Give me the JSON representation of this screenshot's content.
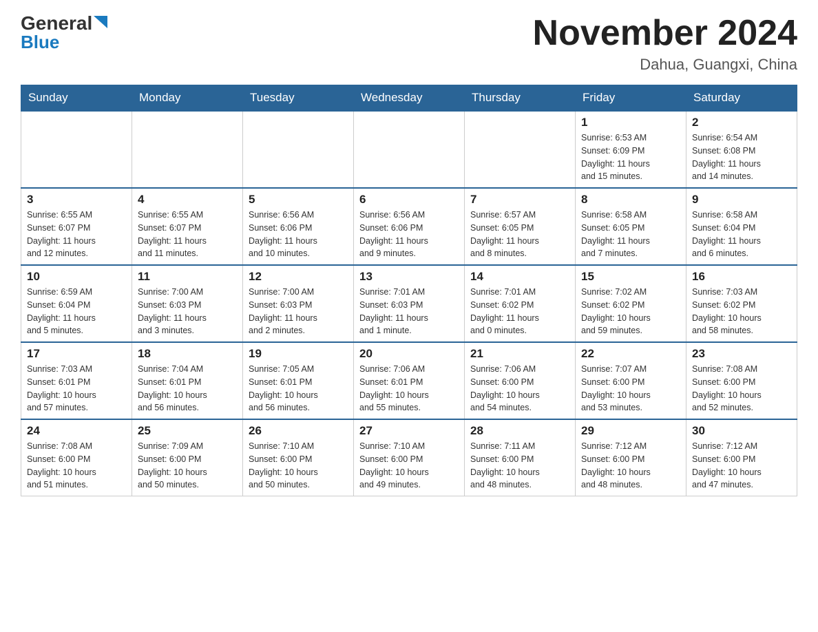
{
  "header": {
    "logo_general": "General",
    "logo_blue": "Blue",
    "month_title": "November 2024",
    "subtitle": "Dahua, Guangxi, China"
  },
  "weekdays": [
    "Sunday",
    "Monday",
    "Tuesday",
    "Wednesday",
    "Thursday",
    "Friday",
    "Saturday"
  ],
  "weeks": [
    [
      {
        "day": "",
        "info": ""
      },
      {
        "day": "",
        "info": ""
      },
      {
        "day": "",
        "info": ""
      },
      {
        "day": "",
        "info": ""
      },
      {
        "day": "",
        "info": ""
      },
      {
        "day": "1",
        "info": "Sunrise: 6:53 AM\nSunset: 6:09 PM\nDaylight: 11 hours\nand 15 minutes."
      },
      {
        "day": "2",
        "info": "Sunrise: 6:54 AM\nSunset: 6:08 PM\nDaylight: 11 hours\nand 14 minutes."
      }
    ],
    [
      {
        "day": "3",
        "info": "Sunrise: 6:55 AM\nSunset: 6:07 PM\nDaylight: 11 hours\nand 12 minutes."
      },
      {
        "day": "4",
        "info": "Sunrise: 6:55 AM\nSunset: 6:07 PM\nDaylight: 11 hours\nand 11 minutes."
      },
      {
        "day": "5",
        "info": "Sunrise: 6:56 AM\nSunset: 6:06 PM\nDaylight: 11 hours\nand 10 minutes."
      },
      {
        "day": "6",
        "info": "Sunrise: 6:56 AM\nSunset: 6:06 PM\nDaylight: 11 hours\nand 9 minutes."
      },
      {
        "day": "7",
        "info": "Sunrise: 6:57 AM\nSunset: 6:05 PM\nDaylight: 11 hours\nand 8 minutes."
      },
      {
        "day": "8",
        "info": "Sunrise: 6:58 AM\nSunset: 6:05 PM\nDaylight: 11 hours\nand 7 minutes."
      },
      {
        "day": "9",
        "info": "Sunrise: 6:58 AM\nSunset: 6:04 PM\nDaylight: 11 hours\nand 6 minutes."
      }
    ],
    [
      {
        "day": "10",
        "info": "Sunrise: 6:59 AM\nSunset: 6:04 PM\nDaylight: 11 hours\nand 5 minutes."
      },
      {
        "day": "11",
        "info": "Sunrise: 7:00 AM\nSunset: 6:03 PM\nDaylight: 11 hours\nand 3 minutes."
      },
      {
        "day": "12",
        "info": "Sunrise: 7:00 AM\nSunset: 6:03 PM\nDaylight: 11 hours\nand 2 minutes."
      },
      {
        "day": "13",
        "info": "Sunrise: 7:01 AM\nSunset: 6:03 PM\nDaylight: 11 hours\nand 1 minute."
      },
      {
        "day": "14",
        "info": "Sunrise: 7:01 AM\nSunset: 6:02 PM\nDaylight: 11 hours\nand 0 minutes."
      },
      {
        "day": "15",
        "info": "Sunrise: 7:02 AM\nSunset: 6:02 PM\nDaylight: 10 hours\nand 59 minutes."
      },
      {
        "day": "16",
        "info": "Sunrise: 7:03 AM\nSunset: 6:02 PM\nDaylight: 10 hours\nand 58 minutes."
      }
    ],
    [
      {
        "day": "17",
        "info": "Sunrise: 7:03 AM\nSunset: 6:01 PM\nDaylight: 10 hours\nand 57 minutes."
      },
      {
        "day": "18",
        "info": "Sunrise: 7:04 AM\nSunset: 6:01 PM\nDaylight: 10 hours\nand 56 minutes."
      },
      {
        "day": "19",
        "info": "Sunrise: 7:05 AM\nSunset: 6:01 PM\nDaylight: 10 hours\nand 56 minutes."
      },
      {
        "day": "20",
        "info": "Sunrise: 7:06 AM\nSunset: 6:01 PM\nDaylight: 10 hours\nand 55 minutes."
      },
      {
        "day": "21",
        "info": "Sunrise: 7:06 AM\nSunset: 6:00 PM\nDaylight: 10 hours\nand 54 minutes."
      },
      {
        "day": "22",
        "info": "Sunrise: 7:07 AM\nSunset: 6:00 PM\nDaylight: 10 hours\nand 53 minutes."
      },
      {
        "day": "23",
        "info": "Sunrise: 7:08 AM\nSunset: 6:00 PM\nDaylight: 10 hours\nand 52 minutes."
      }
    ],
    [
      {
        "day": "24",
        "info": "Sunrise: 7:08 AM\nSunset: 6:00 PM\nDaylight: 10 hours\nand 51 minutes."
      },
      {
        "day": "25",
        "info": "Sunrise: 7:09 AM\nSunset: 6:00 PM\nDaylight: 10 hours\nand 50 minutes."
      },
      {
        "day": "26",
        "info": "Sunrise: 7:10 AM\nSunset: 6:00 PM\nDaylight: 10 hours\nand 50 minutes."
      },
      {
        "day": "27",
        "info": "Sunrise: 7:10 AM\nSunset: 6:00 PM\nDaylight: 10 hours\nand 49 minutes."
      },
      {
        "day": "28",
        "info": "Sunrise: 7:11 AM\nSunset: 6:00 PM\nDaylight: 10 hours\nand 48 minutes."
      },
      {
        "day": "29",
        "info": "Sunrise: 7:12 AM\nSunset: 6:00 PM\nDaylight: 10 hours\nand 48 minutes."
      },
      {
        "day": "30",
        "info": "Sunrise: 7:12 AM\nSunset: 6:00 PM\nDaylight: 10 hours\nand 47 minutes."
      }
    ]
  ]
}
